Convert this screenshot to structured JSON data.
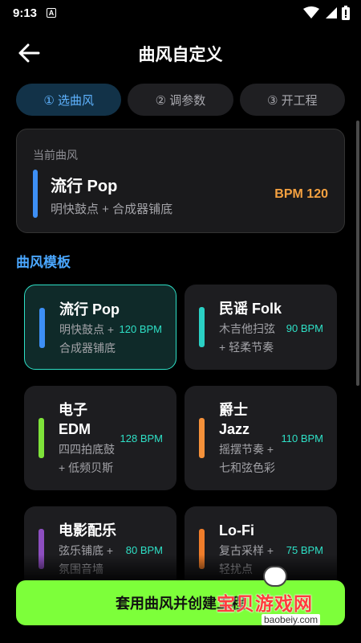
{
  "status": {
    "time": "9:13",
    "notice": "A"
  },
  "header": {
    "title": "曲风自定义"
  },
  "steps": [
    {
      "label": "① 选曲风"
    },
    {
      "label": "② 调参数"
    },
    {
      "label": "③ 开工程"
    }
  ],
  "current": {
    "label": "当前曲风",
    "name": "流行 Pop",
    "desc": "明快鼓点 + 合成器铺底",
    "bpm": "BPM 120",
    "accent": "#3d8ff5"
  },
  "section_title": "曲风模板",
  "templates": [
    {
      "name": "流行 Pop",
      "desc": "明快鼓点 + 合成器铺底",
      "bpm": "120 BPM",
      "accent": "#3d8ff5",
      "selected": true
    },
    {
      "name": "民谣 Folk",
      "desc": "木吉他扫弦 + 轻柔节奏",
      "bpm": "90 BPM",
      "accent": "#2ad0c4",
      "selected": false
    },
    {
      "name": "电子 EDM",
      "desc": "四四拍底鼓 + 低频贝斯",
      "bpm": "128 BPM",
      "accent": "#7ee33a",
      "selected": false
    },
    {
      "name": "爵士 Jazz",
      "desc": "摇摆节奏 + 七和弦色彩",
      "bpm": "110 BPM",
      "accent": "#f5913a",
      "selected": false
    },
    {
      "name": "电影配乐",
      "desc": "弦乐铺底 + 氛围音墙",
      "bpm": "80 BPM",
      "accent": "#8d4ec0",
      "selected": false
    },
    {
      "name": "Lo-Fi",
      "desc": "复古采样 + 轻扰点",
      "bpm": "75 BPM",
      "accent": "#f07d2a",
      "selected": false
    }
  ],
  "cta": {
    "label": "套用曲风并创建工程"
  },
  "watermark": {
    "text": "宝贝游戏网",
    "url": "baobeiy.com"
  }
}
